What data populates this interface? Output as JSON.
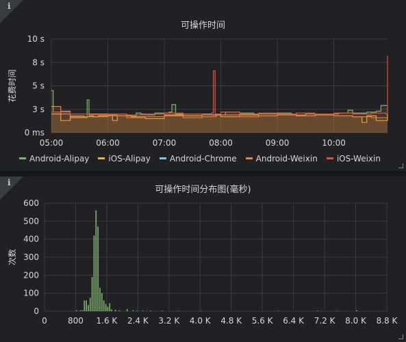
{
  "panels": [
    {
      "title": "可操作时间",
      "info_icon": "i"
    },
    {
      "title": "可操作时间分布图(毫秒)",
      "info_icon": "i"
    }
  ],
  "chart_data": [
    {
      "type": "line",
      "title": "可操作时间",
      "ylabel": "花费时间",
      "yticks": [
        "0 ms",
        "3 s",
        "5 s",
        "8 s",
        "10 s"
      ],
      "ytick_values": [
        0,
        2.5,
        5,
        7.5,
        10
      ],
      "ylim": [
        0,
        10
      ],
      "xticks": [
        "05:00",
        "06:00",
        "07:00",
        "08:00",
        "09:00",
        "10:00"
      ],
      "x_unit": "minutes after 05:00",
      "xlim": [
        0,
        357
      ],
      "grid": true,
      "legend_position": "bottom",
      "series": [
        {
          "name": "Android-Alipay",
          "color": "#7eb26d",
          "points": [
            [
              0,
              4.5
            ],
            [
              2,
              2.2
            ],
            [
              10,
              2.3
            ],
            [
              20,
              1.8
            ],
            [
              35,
              1.6
            ],
            [
              38,
              3.5
            ],
            [
              40,
              1.8
            ],
            [
              45,
              1.7
            ],
            [
              60,
              1.9
            ],
            [
              70,
              2.0
            ],
            [
              80,
              1.8
            ],
            [
              90,
              2.1
            ],
            [
              95,
              2.0
            ],
            [
              100,
              1.9
            ],
            [
              110,
              2.1
            ],
            [
              125,
              2.2
            ],
            [
              128,
              3.0
            ],
            [
              132,
              2.0
            ],
            [
              150,
              2.0
            ],
            [
              170,
              1.9
            ],
            [
              185,
              2.2
            ],
            [
              200,
              2.1
            ],
            [
              215,
              2.0
            ],
            [
              225,
              2.0
            ],
            [
              240,
              2.1
            ],
            [
              255,
              1.9
            ],
            [
              270,
              2.0
            ],
            [
              290,
              2.0
            ],
            [
              305,
              2.1
            ],
            [
              315,
              2.4
            ],
            [
              320,
              2.1
            ],
            [
              335,
              2.2
            ],
            [
              345,
              2.3
            ],
            [
              350,
              2.9
            ],
            [
              357,
              2.0
            ]
          ]
        },
        {
          "name": "iOS-Alipay",
          "color": "#eab839",
          "points": [
            [
              0,
              2.0
            ],
            [
              10,
              1.3
            ],
            [
              20,
              1.6
            ],
            [
              35,
              1.7
            ],
            [
              50,
              1.8
            ],
            [
              65,
              1.3
            ],
            [
              70,
              1.8
            ],
            [
              85,
              1.7
            ],
            [
              100,
              1.5
            ],
            [
              120,
              1.9
            ],
            [
              140,
              1.8
            ],
            [
              160,
              1.9
            ],
            [
              180,
              1.7
            ],
            [
              200,
              1.9
            ],
            [
              220,
              1.8
            ],
            [
              240,
              2.0
            ],
            [
              260,
              1.8
            ],
            [
              280,
              1.9
            ],
            [
              300,
              1.8
            ],
            [
              320,
              1.7
            ],
            [
              330,
              1.1
            ],
            [
              335,
              1.8
            ],
            [
              345,
              1.3
            ],
            [
              357,
              2.0
            ]
          ]
        },
        {
          "name": "Android-Chrome",
          "color": "#6ed0e0",
          "points": []
        },
        {
          "name": "Android-Weixin",
          "color": "#ef843c",
          "points": [
            [
              0,
              2.8
            ],
            [
              10,
              2.0
            ],
            [
              20,
              1.7
            ],
            [
              40,
              2.0
            ],
            [
              60,
              1.8
            ],
            [
              80,
              1.6
            ],
            [
              100,
              1.7
            ],
            [
              120,
              1.8
            ],
            [
              140,
              1.6
            ],
            [
              160,
              1.7
            ],
            [
              175,
              2.0
            ],
            [
              180,
              1.9
            ],
            [
              200,
              1.7
            ],
            [
              220,
              1.8
            ],
            [
              240,
              1.9
            ],
            [
              260,
              1.8
            ],
            [
              280,
              1.9
            ],
            [
              300,
              1.8
            ],
            [
              320,
              1.7
            ],
            [
              340,
              1.6
            ],
            [
              357,
              1.7
            ]
          ]
        },
        {
          "name": "iOS-Weixin",
          "color": "#e24d42",
          "points": [
            [
              0,
              2.2
            ],
            [
              20,
              2.0
            ],
            [
              40,
              1.9
            ],
            [
              60,
              2.0
            ],
            [
              80,
              1.9
            ],
            [
              100,
              2.0
            ],
            [
              120,
              2.1
            ],
            [
              140,
              2.0
            ],
            [
              160,
              1.9
            ],
            [
              170,
              2.1
            ],
            [
              172,
              6.6
            ],
            [
              174,
              2.0
            ],
            [
              180,
              2.2
            ],
            [
              200,
              2.0
            ],
            [
              220,
              2.1
            ],
            [
              240,
              2.0
            ],
            [
              260,
              2.1
            ],
            [
              280,
              2.0
            ],
            [
              300,
              2.1
            ],
            [
              320,
              2.0
            ],
            [
              340,
              2.1
            ],
            [
              355,
              2.0
            ],
            [
              357,
              8.2
            ]
          ]
        }
      ]
    },
    {
      "type": "bar",
      "title": "可操作时间分布图(毫秒)",
      "ylabel": "次数",
      "yticks": [
        "0",
        "100",
        "200",
        "300",
        "400",
        "500",
        "600"
      ],
      "ytick_values": [
        0,
        100,
        200,
        300,
        400,
        500,
        600
      ],
      "ylim": [
        0,
        600
      ],
      "xticks": [
        "0",
        "800",
        "1.6 K",
        "2.4 K",
        "3.2 K",
        "4.0 K",
        "4.8 K",
        "5.6 K",
        "6.4 K",
        "7.2 K",
        "8.0 K",
        "8.8 K"
      ],
      "xtick_values": [
        0,
        800,
        1600,
        2400,
        3200,
        4000,
        4800,
        5600,
        6400,
        7200,
        8000,
        8800
      ],
      "xlim": [
        0,
        8800
      ],
      "bucket_size": 50,
      "grid": true,
      "color": "#7eb26d",
      "bins": [
        [
          800,
          5
        ],
        [
          900,
          5
        ],
        [
          950,
          5
        ],
        [
          1000,
          60
        ],
        [
          1050,
          60
        ],
        [
          1100,
          35
        ],
        [
          1150,
          75
        ],
        [
          1200,
          190
        ],
        [
          1250,
          420
        ],
        [
          1300,
          560
        ],
        [
          1350,
          470
        ],
        [
          1400,
          130
        ],
        [
          1450,
          100
        ],
        [
          1500,
          60
        ],
        [
          1550,
          40
        ],
        [
          1600,
          25
        ],
        [
          1650,
          45
        ],
        [
          1700,
          10
        ],
        [
          1800,
          8
        ],
        [
          1900,
          5
        ],
        [
          2100,
          12
        ],
        [
          2250,
          5
        ],
        [
          2350,
          3
        ],
        [
          2500,
          3
        ],
        [
          2700,
          3
        ],
        [
          3000,
          3
        ],
        [
          3400,
          2
        ],
        [
          4000,
          2
        ],
        [
          6000,
          2
        ],
        [
          7000,
          3
        ],
        [
          7500,
          2
        ],
        [
          8000,
          5
        ]
      ]
    }
  ],
  "legend": [
    {
      "name": "Android-Alipay",
      "color": "#7eb26d"
    },
    {
      "name": "iOS-Alipay",
      "color": "#eab839"
    },
    {
      "name": "Android-Chrome",
      "color": "#6ed0e0"
    },
    {
      "name": "Android-Weixin",
      "color": "#ef843c"
    },
    {
      "name": "iOS-Weixin",
      "color": "#e24d42"
    }
  ]
}
